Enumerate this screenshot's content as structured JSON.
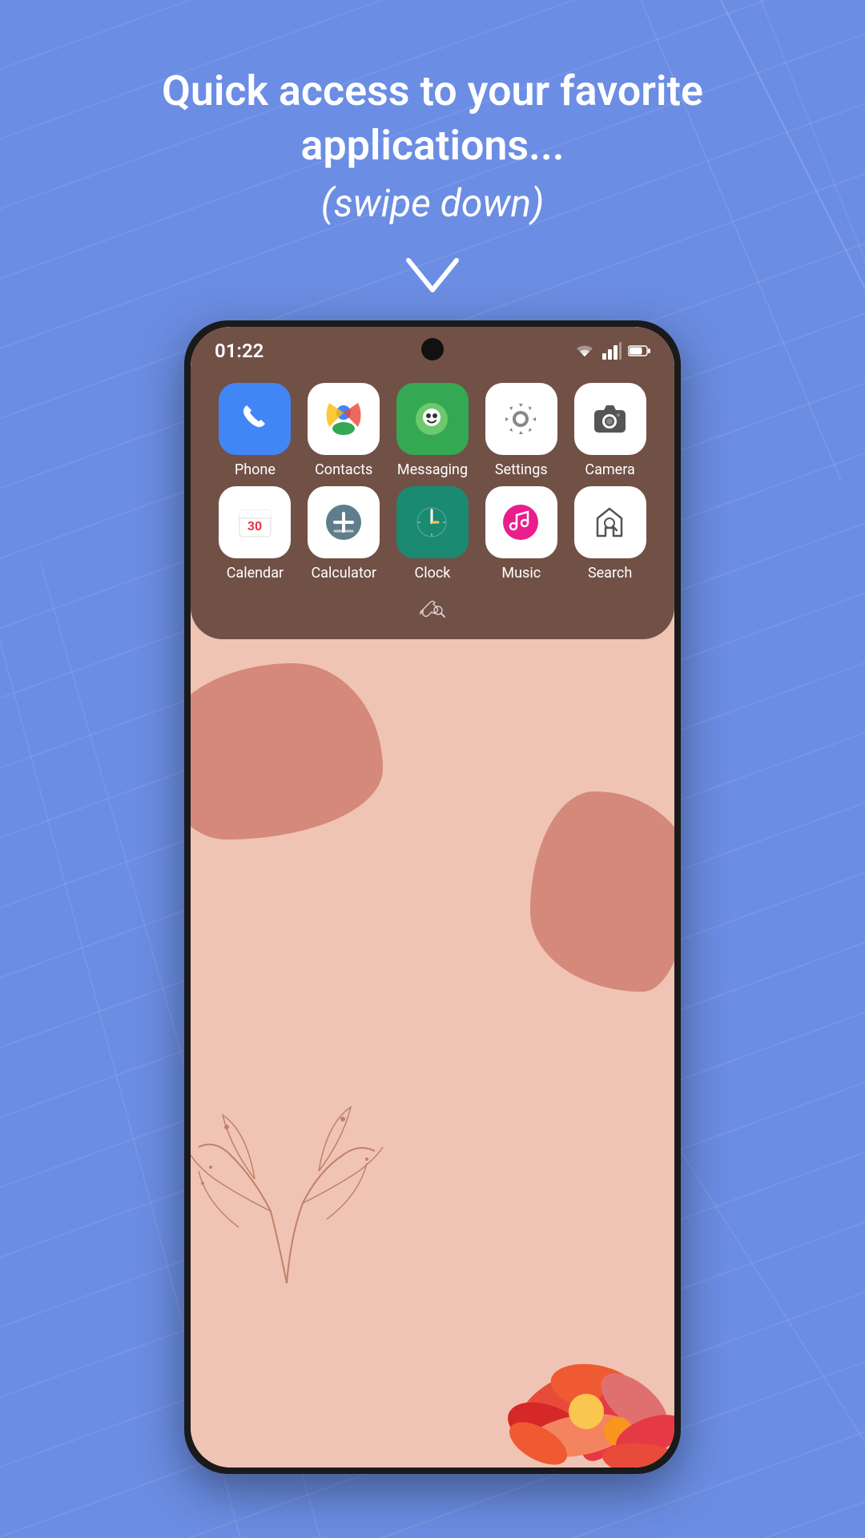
{
  "page": {
    "background_color": "#6b8de3",
    "hero": {
      "title": "Quick access to your favorite applications...",
      "subtitle": "(swipe down)"
    },
    "chevron": "❯"
  },
  "phone": {
    "status_bar": {
      "time": "01:22",
      "wifi_icon": "wifi",
      "signal_icon": "signal",
      "battery_icon": "battery"
    },
    "apps": [
      {
        "id": "phone",
        "label": "Phone",
        "icon_type": "phone",
        "row": 1
      },
      {
        "id": "contacts",
        "label": "Contacts",
        "icon_type": "contacts",
        "row": 1
      },
      {
        "id": "messaging",
        "label": "Messaging",
        "icon_type": "messaging",
        "row": 1
      },
      {
        "id": "settings",
        "label": "Settings",
        "icon_type": "settings",
        "row": 1
      },
      {
        "id": "camera",
        "label": "Camera",
        "icon_type": "camera",
        "row": 1
      },
      {
        "id": "calendar",
        "label": "Calendar",
        "icon_type": "calendar",
        "row": 2
      },
      {
        "id": "calculator",
        "label": "Calculator",
        "icon_type": "calculator",
        "row": 2
      },
      {
        "id": "clock",
        "label": "Clock",
        "icon_type": "clock",
        "row": 2
      },
      {
        "id": "music",
        "label": "Music",
        "icon_type": "music",
        "row": 2
      },
      {
        "id": "search",
        "label": "Search",
        "icon_type": "search",
        "row": 2
      }
    ]
  }
}
